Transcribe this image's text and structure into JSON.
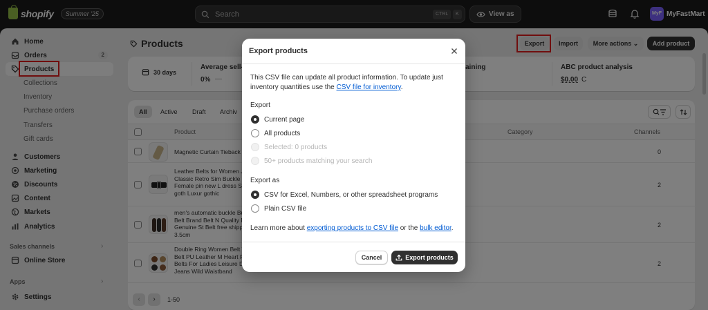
{
  "app": {
    "logo_text": "shopify",
    "edition": "Summer '25",
    "search_placeholder": "Search",
    "kbd_ctrl": "CTRL",
    "kbd_k": "K",
    "view_as": "View as",
    "avatar_initials": "MyF",
    "store_name": "MyFastMart"
  },
  "sidebar": {
    "items": [
      {
        "label": "Home",
        "icon": "home-icon"
      },
      {
        "label": "Orders",
        "icon": "orders-icon",
        "badge": "2"
      },
      {
        "label": "Products",
        "icon": "tag-icon",
        "active": true
      },
      {
        "label": "Collections",
        "sub": true
      },
      {
        "label": "Inventory",
        "sub": true
      },
      {
        "label": "Purchase orders",
        "sub": true
      },
      {
        "label": "Transfers",
        "sub": true
      },
      {
        "label": "Gift cards",
        "sub": true
      },
      {
        "label": "Customers",
        "icon": "person-icon"
      },
      {
        "label": "Marketing",
        "icon": "target-icon"
      },
      {
        "label": "Discounts",
        "icon": "discount-icon"
      },
      {
        "label": "Content",
        "icon": "content-icon"
      },
      {
        "label": "Markets",
        "icon": "globe-icon"
      },
      {
        "label": "Analytics",
        "icon": "chart-icon"
      },
      {
        "label": "Online Store",
        "icon": "store-icon"
      },
      {
        "label": "Settings",
        "icon": "gear-icon"
      }
    ],
    "sales_channels_label": "Sales channels",
    "apps_label": "Apps"
  },
  "header": {
    "title": "Products",
    "export_label": "Export",
    "import_label": "Import",
    "more_actions_label": "More actions",
    "add_product_label": "Add product"
  },
  "metrics": {
    "range": "30 days",
    "avg_label": "Average sell-",
    "avg_value": "0%",
    "remaining_label": "aining",
    "abc_label": "ABC product analysis",
    "abc_value": "$0.00",
    "abc_suffix": "C"
  },
  "table": {
    "tabs": [
      "All",
      "Active",
      "Draft",
      "Archiv"
    ],
    "columns": {
      "product": "Product",
      "category": "Category",
      "channels": "Channels"
    },
    "rows": [
      {
        "name": "Magnetic Curtain Tieback",
        "channels": "0"
      },
      {
        "name": "Leather Belts for Women Jeans Classic Retro Sim Buckle Female pin new L dress Sword goth Luxur gothic",
        "channels": "2"
      },
      {
        "name": "men's automatic buckle Buckle Belt Brand Belt N Quality Male Genuine St Belt free shipping 3.5cm",
        "channels": "2"
      },
      {
        "name": "Double Ring Women Belt Waist Belt PU Leather M Heart Pin Belts For Ladies Leisure Dress Jeans Wild Waistband",
        "channels": "2"
      }
    ],
    "pagination": "1-50"
  },
  "modal": {
    "title": "Export products",
    "desc_prefix": "This CSV file can update all product information. To update just inventory quantities use the ",
    "desc_link": "CSV file for inventory",
    "desc_suffix": ".",
    "export_label": "Export",
    "export_options": [
      {
        "label": "Current page",
        "checked": true,
        "disabled": false
      },
      {
        "label": "All products",
        "checked": false,
        "disabled": false
      },
      {
        "label": "Selected: 0 products",
        "checked": false,
        "disabled": true
      },
      {
        "label": "50+ products matching your search",
        "checked": false,
        "disabled": true
      }
    ],
    "export_as_label": "Export as",
    "format_options": [
      {
        "label": "CSV for Excel, Numbers, or other spreadsheet programs",
        "checked": true
      },
      {
        "label": "Plain CSV file",
        "checked": false
      }
    ],
    "learn_prefix": "Learn more about ",
    "learn_link1": "exporting products to CSV file",
    "learn_mid": " or the ",
    "learn_link2": "bulk editor",
    "learn_suffix": ".",
    "cancel_label": "Cancel",
    "export_button_label": "Export products"
  },
  "colors": {
    "topbar": "#1a1a1a",
    "shell": "#ebebeb",
    "highlight_box": "#e11d1d",
    "primary_button": "#303030",
    "link": "#005bd3"
  }
}
